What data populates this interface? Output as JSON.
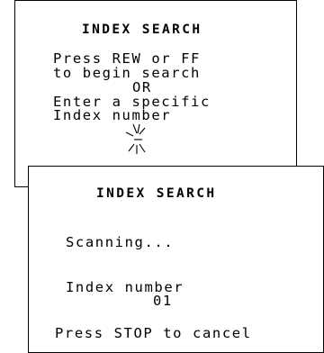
{
  "screen1": {
    "title": "INDEX SEARCH",
    "lines": [
      "Press REW or FF",
      "to begin search",
      "OR",
      "Enter a specific",
      "Index number"
    ]
  },
  "screen2": {
    "title": "INDEX SEARCH",
    "status": "Scanning...",
    "index_label": "Index number",
    "index_value": "01",
    "cancel_hint": "Press STOP to cancel"
  },
  "icons": {
    "input_cursor": "blinking-cursor-icon"
  }
}
